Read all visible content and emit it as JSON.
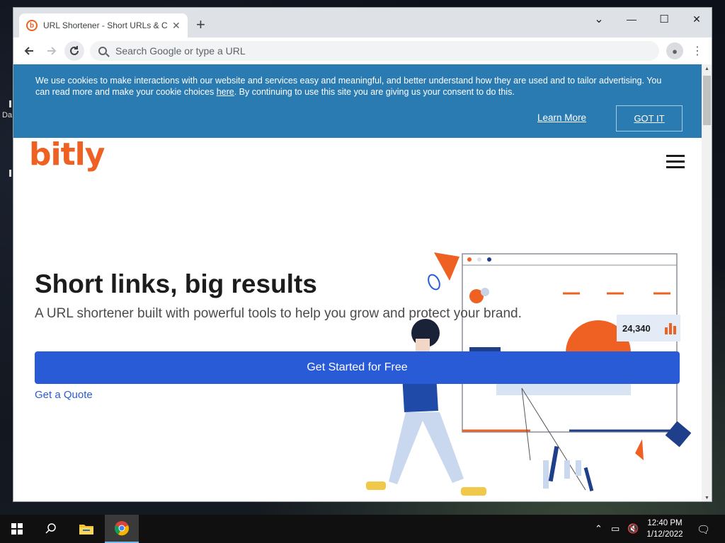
{
  "browser": {
    "tab_title": "URL Shortener - Short URLs & Custom",
    "tab_favicon": "b",
    "newtab": "+",
    "omnibox_placeholder": "Search Google or type a URL",
    "window_controls": {
      "minimize": "—",
      "maximize": "☐",
      "close": "✕",
      "tab_search": "⌄"
    },
    "profile_icon": "●",
    "menu_icon": "⋮"
  },
  "cookie_banner": {
    "text_before": "We use cookies to make interactions with our website and services easy and meaningful, and better understand how they are used and to tailor advertising. You can read more and make your cookie choices ",
    "link": "here",
    "text_after": ". By continuing to use this site you are giving us your consent to do this.",
    "learn_more": "Learn More",
    "got_it": "GOT IT",
    "bg_color": "#2a7bb2"
  },
  "site": {
    "logo": "bitly",
    "brand_color": "#ee6123",
    "hero_title": "Short links, big results",
    "hero_subtitle": "A URL shortener built with powerful tools to help you grow and protect your brand.",
    "cta": "Get Started for Free",
    "cta_color": "#2a5bd7",
    "quote_link": "Get a Quote",
    "illustration_stat": "24,340"
  },
  "taskbar": {
    "time": "12:40 PM",
    "date": "1/12/2022",
    "desktop_label": "Da"
  }
}
